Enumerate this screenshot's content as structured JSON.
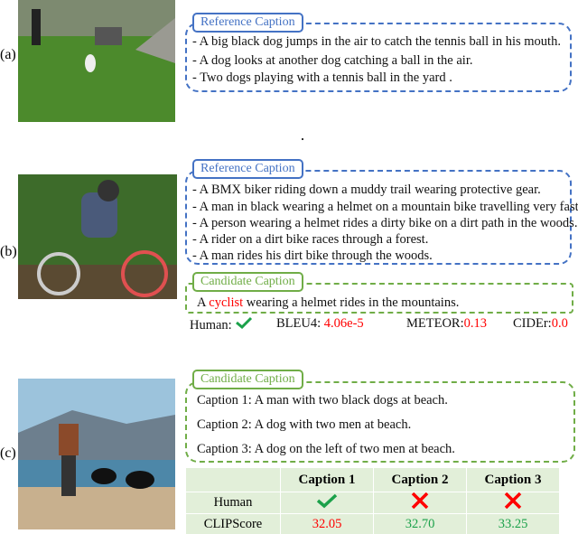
{
  "panels": {
    "a": {
      "marker": "(a)",
      "reference_label": "Reference Caption",
      "reference": [
        "- A big black dog jumps in the air to catch the tennis ball in his mouth.",
        "- A dog looks at another dog catching a ball in the air.",
        "- Two dogs playing with a tennis ball in the yard ."
      ]
    },
    "b": {
      "marker": "(b)",
      "reference_label": "Reference Caption",
      "reference": [
        "- A BMX biker riding down a muddy trail wearing protective gear.",
        "- A man in black wearing a helmet on a mountain bike travelling very fast.",
        "- A person wearing a helmet rides a dirty bike on a dirt path in the woods.",
        "- A rider on a dirt bike races through a forest.",
        "- A man rides his dirt bike through the woods."
      ],
      "candidate_label": "Candidate Caption",
      "candidate": {
        "pre": "A ",
        "highlight": "cyclist",
        "post": " wearing a helmet rides in the mountains."
      },
      "metrics": {
        "human_label": "Human:",
        "human": "check",
        "bleu_label": "BLEU4: ",
        "bleu": "4.06e-5",
        "meteor_label": "METEOR:",
        "meteor": "0.13",
        "cider_label": "CIDEr:",
        "cider": "0.0"
      }
    },
    "c": {
      "marker": "(c)",
      "candidate_label": "Candidate Caption",
      "candidates": [
        "Caption 1: A man with two black dogs at beach.",
        "Caption 2: A dog with two men at beach.",
        "Caption 3: A dog on the left of two men at beach."
      ],
      "table": {
        "headers": [
          "",
          "Caption 1",
          "Caption 2",
          "Caption 3"
        ],
        "human_label": "Human",
        "human": [
          "check",
          "cross",
          "cross"
        ],
        "clip_label": "CLIPScore",
        "clip": [
          "32.05",
          "32.70",
          "33.25"
        ]
      }
    }
  },
  "colors": {
    "reference": "#4472c4",
    "candidate": "#70ad47",
    "bad": "#ff0000",
    "good": "#1ba14a"
  }
}
